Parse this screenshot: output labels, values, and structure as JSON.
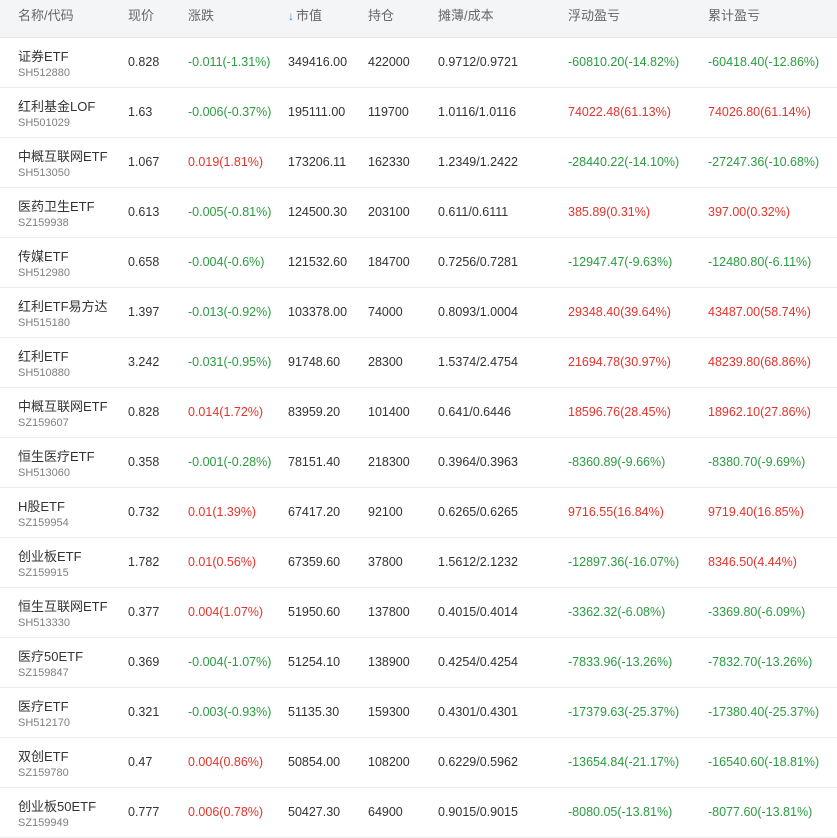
{
  "header": {
    "name": "名称/代码",
    "price": "现价",
    "change": "涨跌",
    "sort_icon": "↓",
    "mktval": "市值",
    "hold": "持仓",
    "cost": "摊薄/成本",
    "float_pl": "浮动盈亏",
    "total_pl": "累计盈亏"
  },
  "colors": {
    "up": "#e5332b",
    "down": "#2a9c3f",
    "header_bg": "#f4f5f7",
    "sort": "#3b7bd4"
  },
  "rows": [
    {
      "name": "证券ETF",
      "code": "SH512880",
      "price": "0.828",
      "change": "-0.011(-1.31%)",
      "mktval": "349416.00",
      "hold": "422000",
      "cost": "0.9712/0.9721",
      "float_pl": "-60810.20(-14.82%)",
      "total_pl": "-60418.40(-12.86%)",
      "change_dir": "down",
      "float_dir": "down",
      "total_dir": "down"
    },
    {
      "name": "红利基金LOF",
      "code": "SH501029",
      "price": "1.63",
      "change": "-0.006(-0.37%)",
      "mktval": "195111.00",
      "hold": "119700",
      "cost": "1.0116/1.0116",
      "float_pl": "74022.48(61.13%)",
      "total_pl": "74026.80(61.14%)",
      "change_dir": "down",
      "float_dir": "up",
      "total_dir": "up"
    },
    {
      "name": "中概互联网ETF",
      "code": "SH513050",
      "price": "1.067",
      "change": "0.019(1.81%)",
      "mktval": "173206.11",
      "hold": "162330",
      "cost": "1.2349/1.2422",
      "float_pl": "-28440.22(-14.10%)",
      "total_pl": "-27247.36(-10.68%)",
      "change_dir": "up",
      "float_dir": "down",
      "total_dir": "down"
    },
    {
      "name": "医药卫生ETF",
      "code": "SZ159938",
      "price": "0.613",
      "change": "-0.005(-0.81%)",
      "mktval": "124500.30",
      "hold": "203100",
      "cost": "0.611/0.6111",
      "float_pl": "385.89(0.31%)",
      "total_pl": "397.00(0.32%)",
      "change_dir": "down",
      "float_dir": "up",
      "total_dir": "up"
    },
    {
      "name": "传媒ETF",
      "code": "SH512980",
      "price": "0.658",
      "change": "-0.004(-0.6%)",
      "mktval": "121532.60",
      "hold": "184700",
      "cost": "0.7256/0.7281",
      "float_pl": "-12947.47(-9.63%)",
      "total_pl": "-12480.80(-6.11%)",
      "change_dir": "down",
      "float_dir": "down",
      "total_dir": "down"
    },
    {
      "name": "红利ETF易方达",
      "code": "SH515180",
      "price": "1.397",
      "change": "-0.013(-0.92%)",
      "mktval": "103378.00",
      "hold": "74000",
      "cost": "0.8093/1.0004",
      "float_pl": "29348.40(39.64%)",
      "total_pl": "43487.00(58.74%)",
      "change_dir": "down",
      "float_dir": "up",
      "total_dir": "up"
    },
    {
      "name": "红利ETF",
      "code": "SH510880",
      "price": "3.242",
      "change": "-0.031(-0.95%)",
      "mktval": "91748.60",
      "hold": "28300",
      "cost": "1.5374/2.4754",
      "float_pl": "21694.78(30.97%)",
      "total_pl": "48239.80(68.86%)",
      "change_dir": "down",
      "float_dir": "up",
      "total_dir": "up"
    },
    {
      "name": "中概互联网ETF",
      "code": "SZ159607",
      "price": "0.828",
      "change": "0.014(1.72%)",
      "mktval": "83959.20",
      "hold": "101400",
      "cost": "0.641/0.6446",
      "float_pl": "18596.76(28.45%)",
      "total_pl": "18962.10(27.86%)",
      "change_dir": "up",
      "float_dir": "up",
      "total_dir": "up"
    },
    {
      "name": "恒生医疗ETF",
      "code": "SH513060",
      "price": "0.358",
      "change": "-0.001(-0.28%)",
      "mktval": "78151.40",
      "hold": "218300",
      "cost": "0.3964/0.3963",
      "float_pl": "-8360.89(-9.66%)",
      "total_pl": "-8380.70(-9.69%)",
      "change_dir": "down",
      "float_dir": "down",
      "total_dir": "down"
    },
    {
      "name": "H股ETF",
      "code": "SZ159954",
      "price": "0.732",
      "change": "0.01(1.39%)",
      "mktval": "67417.20",
      "hold": "92100",
      "cost": "0.6265/0.6265",
      "float_pl": "9716.55(16.84%)",
      "total_pl": "9719.40(16.85%)",
      "change_dir": "up",
      "float_dir": "up",
      "total_dir": "up"
    },
    {
      "name": "创业板ETF",
      "code": "SZ159915",
      "price": "1.782",
      "change": "0.01(0.56%)",
      "mktval": "67359.60",
      "hold": "37800",
      "cost": "1.5612/2.1232",
      "float_pl": "-12897.36(-16.07%)",
      "total_pl": "8346.50(4.44%)",
      "change_dir": "up",
      "float_dir": "down",
      "total_dir": "up"
    },
    {
      "name": "恒生互联网ETF",
      "code": "SH513330",
      "price": "0.377",
      "change": "0.004(1.07%)",
      "mktval": "51950.60",
      "hold": "137800",
      "cost": "0.4015/0.4014",
      "float_pl": "-3362.32(-6.08%)",
      "total_pl": "-3369.80(-6.09%)",
      "change_dir": "up",
      "float_dir": "down",
      "total_dir": "down"
    },
    {
      "name": "医疗50ETF",
      "code": "SZ159847",
      "price": "0.369",
      "change": "-0.004(-1.07%)",
      "mktval": "51254.10",
      "hold": "138900",
      "cost": "0.4254/0.4254",
      "float_pl": "-7833.96(-13.26%)",
      "total_pl": "-7832.70(-13.26%)",
      "change_dir": "down",
      "float_dir": "down",
      "total_dir": "down"
    },
    {
      "name": "医疗ETF",
      "code": "SH512170",
      "price": "0.321",
      "change": "-0.003(-0.93%)",
      "mktval": "51135.30",
      "hold": "159300",
      "cost": "0.4301/0.4301",
      "float_pl": "-17379.63(-25.37%)",
      "total_pl": "-17380.40(-25.37%)",
      "change_dir": "down",
      "float_dir": "down",
      "total_dir": "down"
    },
    {
      "name": "双创ETF",
      "code": "SZ159780",
      "price": "0.47",
      "change": "0.004(0.86%)",
      "mktval": "50854.00",
      "hold": "108200",
      "cost": "0.6229/0.5962",
      "float_pl": "-13654.84(-21.17%)",
      "total_pl": "-16540.60(-18.81%)",
      "change_dir": "up",
      "float_dir": "down",
      "total_dir": "down"
    },
    {
      "name": "创业板50ETF",
      "code": "SZ159949",
      "price": "0.777",
      "change": "0.006(0.78%)",
      "mktval": "50427.30",
      "hold": "64900",
      "cost": "0.9015/0.9015",
      "float_pl": "-8080.05(-13.81%)",
      "total_pl": "-8077.60(-13.81%)",
      "change_dir": "up",
      "float_dir": "down",
      "total_dir": "down"
    }
  ]
}
